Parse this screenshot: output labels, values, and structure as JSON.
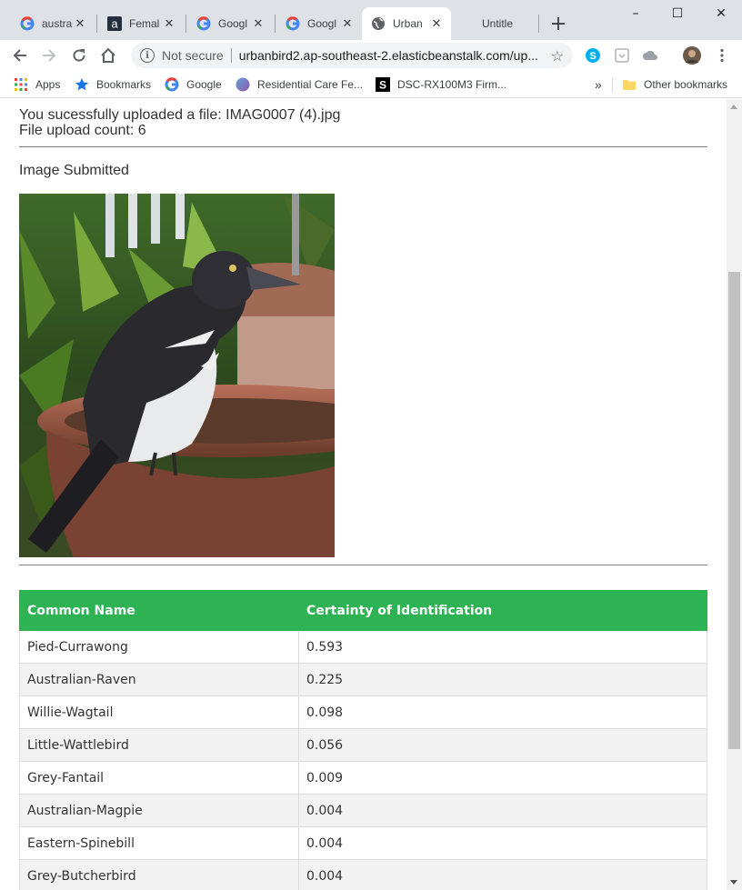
{
  "browser": {
    "tabs": [
      {
        "title": "austra",
        "icon": "google-g-icon"
      },
      {
        "title": "Femal",
        "icon": "amazon-a-icon"
      },
      {
        "title": "Googl",
        "icon": "google-g-icon"
      },
      {
        "title": "Googl",
        "icon": "google-g-icon"
      },
      {
        "title": "Urban",
        "icon": "globe-icon",
        "active": true
      },
      {
        "title": "Untitle",
        "icon": "none"
      }
    ],
    "window_controls": {
      "minimize": "–",
      "maximize": "☐",
      "close": "✕"
    },
    "toolbar": {
      "security_label": "Not secure",
      "url": "urbanbird2.ap-southeast-2.elasticbeanstalk.com/up..."
    },
    "bookmarks": [
      {
        "label": "Apps",
        "icon": "apps-grid-icon"
      },
      {
        "label": "Bookmarks",
        "icon": "star-icon"
      },
      {
        "label": "Google",
        "icon": "google-g-icon"
      },
      {
        "label": "Residential Care Fe...",
        "icon": "site-circle-icon"
      },
      {
        "label": "DSC-RX100M3 Firm...",
        "icon": "s-logo-icon"
      }
    ],
    "overflow_label": "»",
    "other_bookmarks": "Other bookmarks"
  },
  "page": {
    "upload_message": "You sucessfully uploaded a file: IMAG0007 (4).jpg",
    "upload_count": "File upload count: 6",
    "image_heading": "Image Submitted",
    "table": {
      "headers": [
        "Common Name",
        "Certainty of Identification"
      ],
      "rows": [
        [
          "Pied-Currawong",
          "0.593"
        ],
        [
          "Australian-Raven",
          "0.225"
        ],
        [
          "Willie-Wagtail",
          "0.098"
        ],
        [
          "Little-Wattlebird",
          "0.056"
        ],
        [
          "Grey-Fantail",
          "0.009"
        ],
        [
          "Australian-Magpie",
          "0.004"
        ],
        [
          "Eastern-Spinebill",
          "0.004"
        ],
        [
          "Grey-Butcherbird",
          "0.004"
        ]
      ]
    }
  },
  "colors": {
    "table_header": "#2db254",
    "tab_strip": "#dee1e6"
  }
}
